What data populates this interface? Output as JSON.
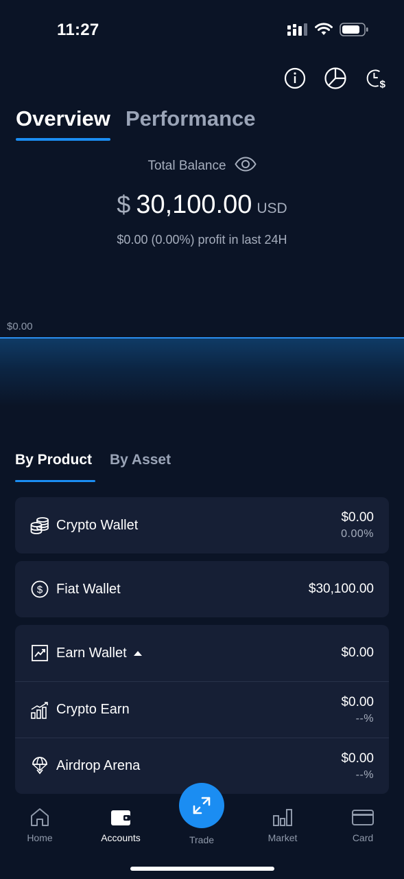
{
  "status_bar": {
    "time": "11:27"
  },
  "header": {
    "icons": [
      "info-icon",
      "pie-chart-icon",
      "clock-dollar-icon"
    ]
  },
  "top_tabs": [
    {
      "label": "Overview",
      "active": true
    },
    {
      "label": "Performance",
      "active": false
    }
  ],
  "balance": {
    "label": "Total Balance",
    "currency_symbol": "$",
    "amount": "30,100.00",
    "unit": "USD",
    "profit": "$0.00 (0.00%) profit in last 24H"
  },
  "chart": {
    "y_label": "$0.00"
  },
  "sub_tabs": [
    {
      "label": "By Product",
      "active": true
    },
    {
      "label": "By Asset",
      "active": false
    }
  ],
  "wallets": {
    "crypto": {
      "label": "Crypto Wallet",
      "value": "$0.00",
      "sub": "0.00%",
      "icon": "coins-icon"
    },
    "fiat": {
      "label": "Fiat Wallet",
      "value": "$30,100.00",
      "icon": "dollar-circle-icon"
    },
    "earn": {
      "label": "Earn Wallet",
      "value": "$0.00",
      "icon": "trend-chart-icon",
      "children": [
        {
          "label": "Crypto Earn",
          "value": "$0.00",
          "sub": "--%",
          "icon": "bar-growth-icon"
        },
        {
          "label": "Airdrop Arena",
          "value": "$0.00",
          "sub": "--%",
          "icon": "parachute-icon"
        }
      ]
    }
  },
  "nav": {
    "items": [
      {
        "label": "Home",
        "icon": "home-icon"
      },
      {
        "label": "Accounts",
        "icon": "wallet-icon",
        "active": true
      },
      {
        "label": "Trade",
        "icon": "swap-arrows-icon"
      },
      {
        "label": "Market",
        "icon": "bar-chart-icon"
      },
      {
        "label": "Card",
        "icon": "card-icon"
      }
    ]
  },
  "colors": {
    "background": "#0b1426",
    "card": "#161f35",
    "accent": "#1b8df2",
    "muted": "#a6aebd"
  }
}
